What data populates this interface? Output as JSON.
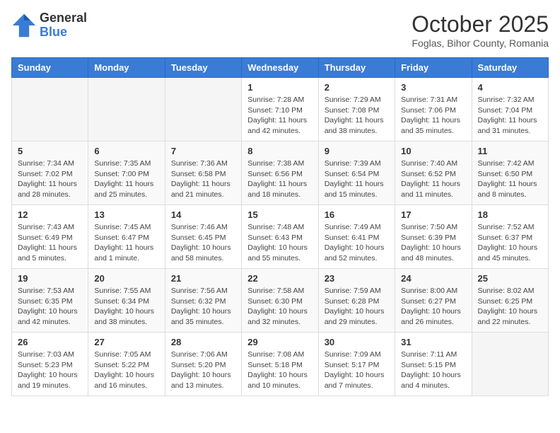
{
  "logo": {
    "general": "General",
    "blue": "Blue"
  },
  "title": {
    "month": "October 2025",
    "location": "Foglas, Bihor County, Romania"
  },
  "weekdays": [
    "Sunday",
    "Monday",
    "Tuesday",
    "Wednesday",
    "Thursday",
    "Friday",
    "Saturday"
  ],
  "weeks": [
    [
      {
        "day": "",
        "info": ""
      },
      {
        "day": "",
        "info": ""
      },
      {
        "day": "",
        "info": ""
      },
      {
        "day": "1",
        "info": "Sunrise: 7:28 AM\nSunset: 7:10 PM\nDaylight: 11 hours\nand 42 minutes."
      },
      {
        "day": "2",
        "info": "Sunrise: 7:29 AM\nSunset: 7:08 PM\nDaylight: 11 hours\nand 38 minutes."
      },
      {
        "day": "3",
        "info": "Sunrise: 7:31 AM\nSunset: 7:06 PM\nDaylight: 11 hours\nand 35 minutes."
      },
      {
        "day": "4",
        "info": "Sunrise: 7:32 AM\nSunset: 7:04 PM\nDaylight: 11 hours\nand 31 minutes."
      }
    ],
    [
      {
        "day": "5",
        "info": "Sunrise: 7:34 AM\nSunset: 7:02 PM\nDaylight: 11 hours\nand 28 minutes."
      },
      {
        "day": "6",
        "info": "Sunrise: 7:35 AM\nSunset: 7:00 PM\nDaylight: 11 hours\nand 25 minutes."
      },
      {
        "day": "7",
        "info": "Sunrise: 7:36 AM\nSunset: 6:58 PM\nDaylight: 11 hours\nand 21 minutes."
      },
      {
        "day": "8",
        "info": "Sunrise: 7:38 AM\nSunset: 6:56 PM\nDaylight: 11 hours\nand 18 minutes."
      },
      {
        "day": "9",
        "info": "Sunrise: 7:39 AM\nSunset: 6:54 PM\nDaylight: 11 hours\nand 15 minutes."
      },
      {
        "day": "10",
        "info": "Sunrise: 7:40 AM\nSunset: 6:52 PM\nDaylight: 11 hours\nand 11 minutes."
      },
      {
        "day": "11",
        "info": "Sunrise: 7:42 AM\nSunset: 6:50 PM\nDaylight: 11 hours\nand 8 minutes."
      }
    ],
    [
      {
        "day": "12",
        "info": "Sunrise: 7:43 AM\nSunset: 6:49 PM\nDaylight: 11 hours\nand 5 minutes."
      },
      {
        "day": "13",
        "info": "Sunrise: 7:45 AM\nSunset: 6:47 PM\nDaylight: 11 hours\nand 1 minute."
      },
      {
        "day": "14",
        "info": "Sunrise: 7:46 AM\nSunset: 6:45 PM\nDaylight: 10 hours\nand 58 minutes."
      },
      {
        "day": "15",
        "info": "Sunrise: 7:48 AM\nSunset: 6:43 PM\nDaylight: 10 hours\nand 55 minutes."
      },
      {
        "day": "16",
        "info": "Sunrise: 7:49 AM\nSunset: 6:41 PM\nDaylight: 10 hours\nand 52 minutes."
      },
      {
        "day": "17",
        "info": "Sunrise: 7:50 AM\nSunset: 6:39 PM\nDaylight: 10 hours\nand 48 minutes."
      },
      {
        "day": "18",
        "info": "Sunrise: 7:52 AM\nSunset: 6:37 PM\nDaylight: 10 hours\nand 45 minutes."
      }
    ],
    [
      {
        "day": "19",
        "info": "Sunrise: 7:53 AM\nSunset: 6:35 PM\nDaylight: 10 hours\nand 42 minutes."
      },
      {
        "day": "20",
        "info": "Sunrise: 7:55 AM\nSunset: 6:34 PM\nDaylight: 10 hours\nand 38 minutes."
      },
      {
        "day": "21",
        "info": "Sunrise: 7:56 AM\nSunset: 6:32 PM\nDaylight: 10 hours\nand 35 minutes."
      },
      {
        "day": "22",
        "info": "Sunrise: 7:58 AM\nSunset: 6:30 PM\nDaylight: 10 hours\nand 32 minutes."
      },
      {
        "day": "23",
        "info": "Sunrise: 7:59 AM\nSunset: 6:28 PM\nDaylight: 10 hours\nand 29 minutes."
      },
      {
        "day": "24",
        "info": "Sunrise: 8:00 AM\nSunset: 6:27 PM\nDaylight: 10 hours\nand 26 minutes."
      },
      {
        "day": "25",
        "info": "Sunrise: 8:02 AM\nSunset: 6:25 PM\nDaylight: 10 hours\nand 22 minutes."
      }
    ],
    [
      {
        "day": "26",
        "info": "Sunrise: 7:03 AM\nSunset: 5:23 PM\nDaylight: 10 hours\nand 19 minutes."
      },
      {
        "day": "27",
        "info": "Sunrise: 7:05 AM\nSunset: 5:22 PM\nDaylight: 10 hours\nand 16 minutes."
      },
      {
        "day": "28",
        "info": "Sunrise: 7:06 AM\nSunset: 5:20 PM\nDaylight: 10 hours\nand 13 minutes."
      },
      {
        "day": "29",
        "info": "Sunrise: 7:08 AM\nSunset: 5:18 PM\nDaylight: 10 hours\nand 10 minutes."
      },
      {
        "day": "30",
        "info": "Sunrise: 7:09 AM\nSunset: 5:17 PM\nDaylight: 10 hours\nand 7 minutes."
      },
      {
        "day": "31",
        "info": "Sunrise: 7:11 AM\nSunset: 5:15 PM\nDaylight: 10 hours\nand 4 minutes."
      },
      {
        "day": "",
        "info": ""
      }
    ]
  ]
}
